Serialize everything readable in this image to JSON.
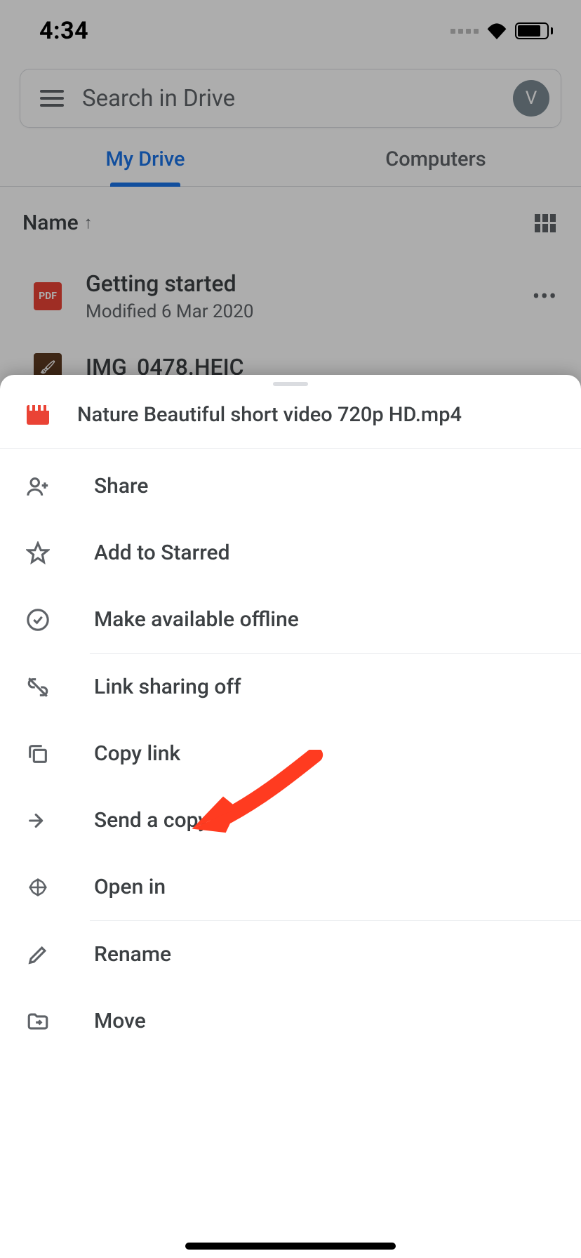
{
  "status": {
    "time": "4:34"
  },
  "search": {
    "placeholder": "Search in Drive",
    "avatar_initial": "V"
  },
  "tabs": {
    "my_drive": "My Drive",
    "computers": "Computers"
  },
  "sort": {
    "label": "Name"
  },
  "files": [
    {
      "name": "Getting started",
      "meta": "Modified 6 Mar 2020",
      "icon_label": "PDF"
    },
    {
      "name": "IMG_0478.HEIC",
      "meta": "",
      "icon_label": ""
    }
  ],
  "sheet": {
    "file_name": "Nature Beautiful short video 720p HD.mp4",
    "actions": {
      "share": "Share",
      "star": "Add to Starred",
      "offline": "Make available offline",
      "link_sharing": "Link sharing off",
      "copy_link": "Copy link",
      "send_copy": "Send a copy",
      "open_in": "Open in",
      "rename": "Rename",
      "move": "Move"
    }
  }
}
